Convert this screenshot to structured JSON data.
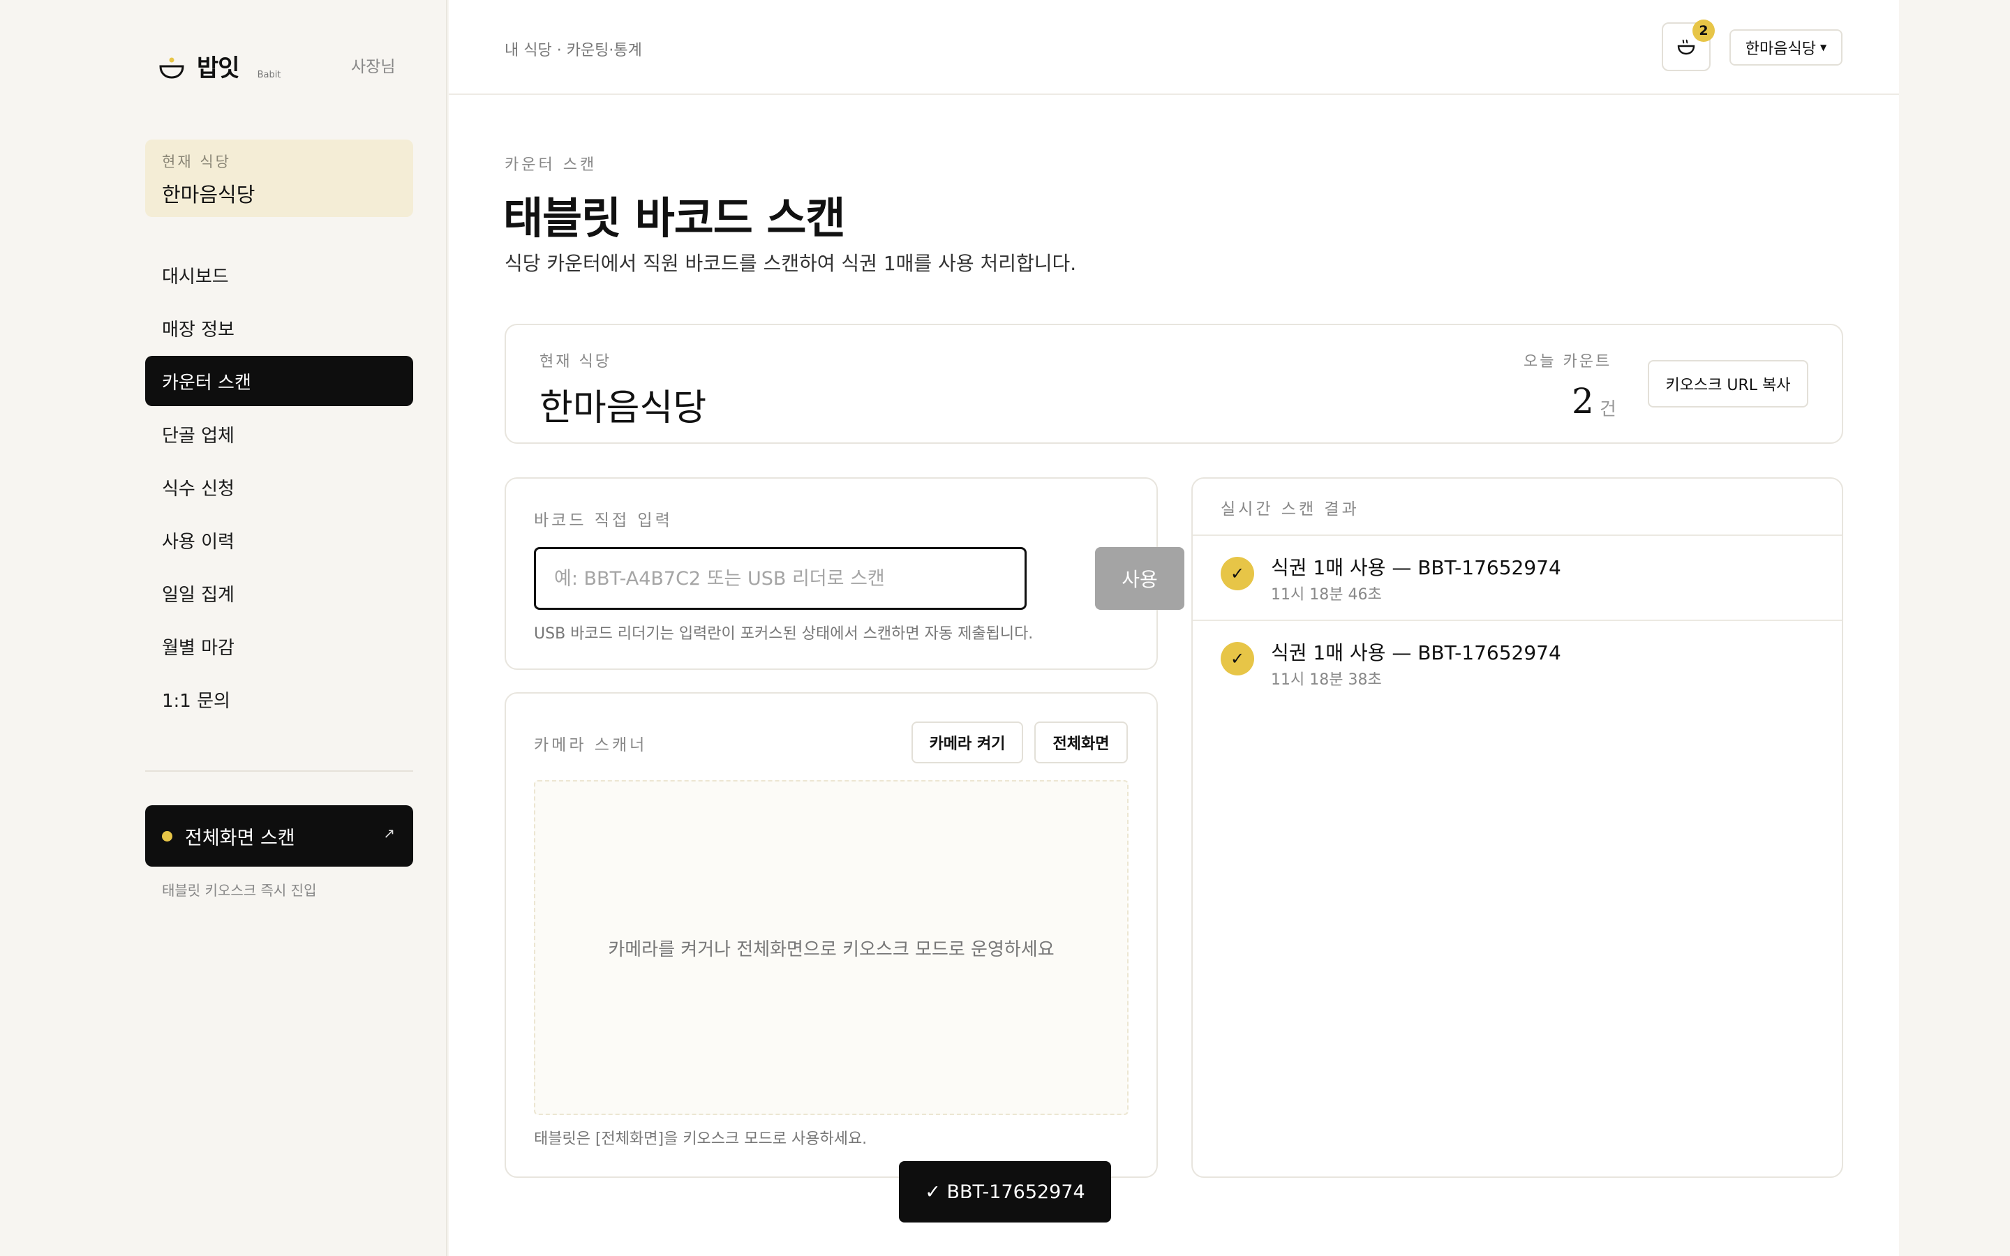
{
  "brand": {
    "name": "밥잇",
    "sub": "Babit",
    "role": "사장님"
  },
  "sidebar": {
    "current_label": "현재 식당",
    "current_value": "한마음식당",
    "items": [
      {
        "label": "대시보드",
        "active": false
      },
      {
        "label": "매장 정보",
        "active": false
      },
      {
        "label": "카운터 스캔",
        "active": true
      },
      {
        "label": "단골 업체",
        "active": false
      },
      {
        "label": "식수 신청",
        "active": false
      },
      {
        "label": "사용 이력",
        "active": false
      },
      {
        "label": "일일 집계",
        "active": false
      },
      {
        "label": "월별 마감",
        "active": false
      },
      {
        "label": "1:1 문의",
        "active": false
      }
    ],
    "fullscreen_button": "전체화면 스캔",
    "fullscreen_hint": "태블릿 키오스크 즉시 진입"
  },
  "topbar": {
    "breadcrumb": "내 식당 · 카운팅·통계",
    "notification_count": "2",
    "store_select": "한마음식당"
  },
  "page": {
    "eyebrow": "카운터 스캔",
    "title": "태블릿 바코드 스캔",
    "description": "식당 카운터에서 직원 바코드를 스캔하여 식권 1매를 사용 처리합니다."
  },
  "summary": {
    "store_label": "현재 식당",
    "store_value": "한마음식당",
    "count_label": "오늘 카운트",
    "count_value": "2",
    "count_unit": "건",
    "kiosk_button": "키오스크 URL 복사"
  },
  "manual_input": {
    "label": "바코드 직접 입력",
    "placeholder": "예: BBT-A4B7C2 또는 USB 리더로 스캔",
    "value": "",
    "submit": "사용",
    "hint": "USB 바코드 리더기는 입력란이 포커스된 상태에서 스캔하면 자동 제출됩니다."
  },
  "camera": {
    "label": "카메라 스캐너",
    "on_button": "카메라 켜기",
    "fullscreen_button": "전체화면",
    "placeholder": "카메라를 켜거나 전체화면으로 키오스크 모드로 운영하세요",
    "hint": "태블릿은 [전체화면]을 키오스크 모드로 사용하세요."
  },
  "results": {
    "label": "실시간 스캔 결과",
    "items": [
      {
        "title": "식권 1매 사용 — BBT-17652974",
        "time": "11시 18분 46초"
      },
      {
        "title": "식권 1매 사용 — BBT-17652974",
        "time": "11시 18분 38초"
      }
    ]
  },
  "toast": "✓ BBT-17652974",
  "colors": {
    "accent": "#e7c547",
    "dark": "#0e0e0e",
    "highlight_bg": "#f4edd6"
  }
}
